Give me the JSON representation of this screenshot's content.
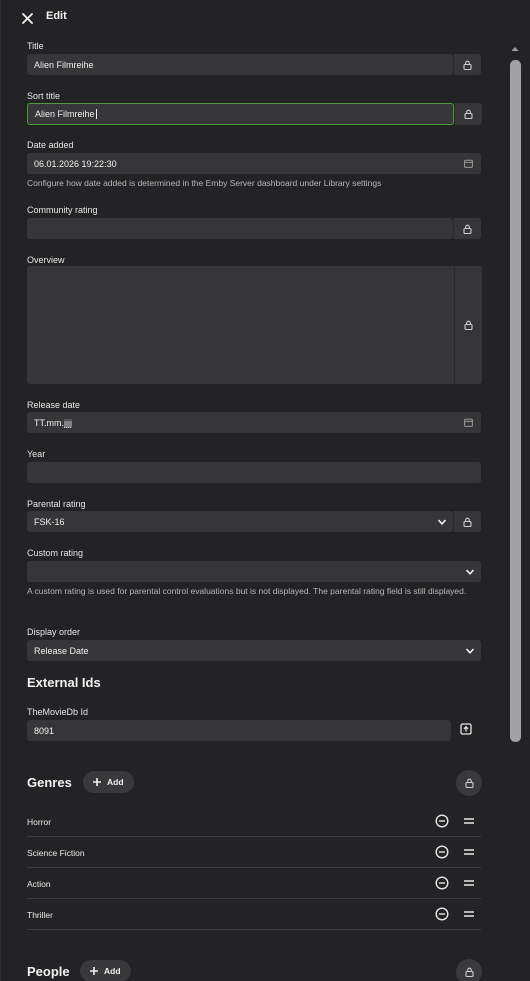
{
  "header": {
    "title": "Edit"
  },
  "fields": {
    "title": {
      "label": "Title",
      "value": "Alien Filmreihe"
    },
    "sort_title": {
      "label": "Sort title",
      "value": "Alien Filmreihe"
    },
    "date_added": {
      "label": "Date added",
      "value": "06.01.2026 19:22:30",
      "hint": "Configure how date added is determined in the Emby Server dashboard under Library settings"
    },
    "community_rating": {
      "label": "Community rating",
      "value": ""
    },
    "overview": {
      "label": "Overview",
      "value": ""
    },
    "release_date": {
      "label": "Release date",
      "value": "TT.mm.jjjj"
    },
    "year": {
      "label": "Year",
      "value": ""
    },
    "parental_rating": {
      "label": "Parental rating",
      "value": "FSK-16"
    },
    "custom_rating": {
      "label": "Custom rating",
      "value": "",
      "hint": "A custom rating is used for parental control evaluations but is not displayed. The parental rating field is still displayed."
    },
    "display_order": {
      "label": "Display order",
      "value": "Release Date"
    }
  },
  "external_ids": {
    "title": "External Ids",
    "tmdb": {
      "label": "TheMovieDb Id",
      "value": "8091"
    }
  },
  "genres": {
    "title": "Genres",
    "add_label": "Add",
    "items": [
      "Horror",
      "Science Fiction",
      "Action",
      "Thriller"
    ]
  },
  "people": {
    "title": "People",
    "add_label": "Add"
  },
  "icons": {
    "close": "close-icon",
    "lock": "lock-icon",
    "calendar": "calendar-icon",
    "chevron": "chevron-down-icon",
    "plus": "plus-icon",
    "remove": "minus-circle-icon",
    "drag": "drag-handle-icon",
    "open": "open-external-icon"
  },
  "colors": {
    "background": "#232325",
    "field": "#363638",
    "focus": "#4f9a3e"
  }
}
